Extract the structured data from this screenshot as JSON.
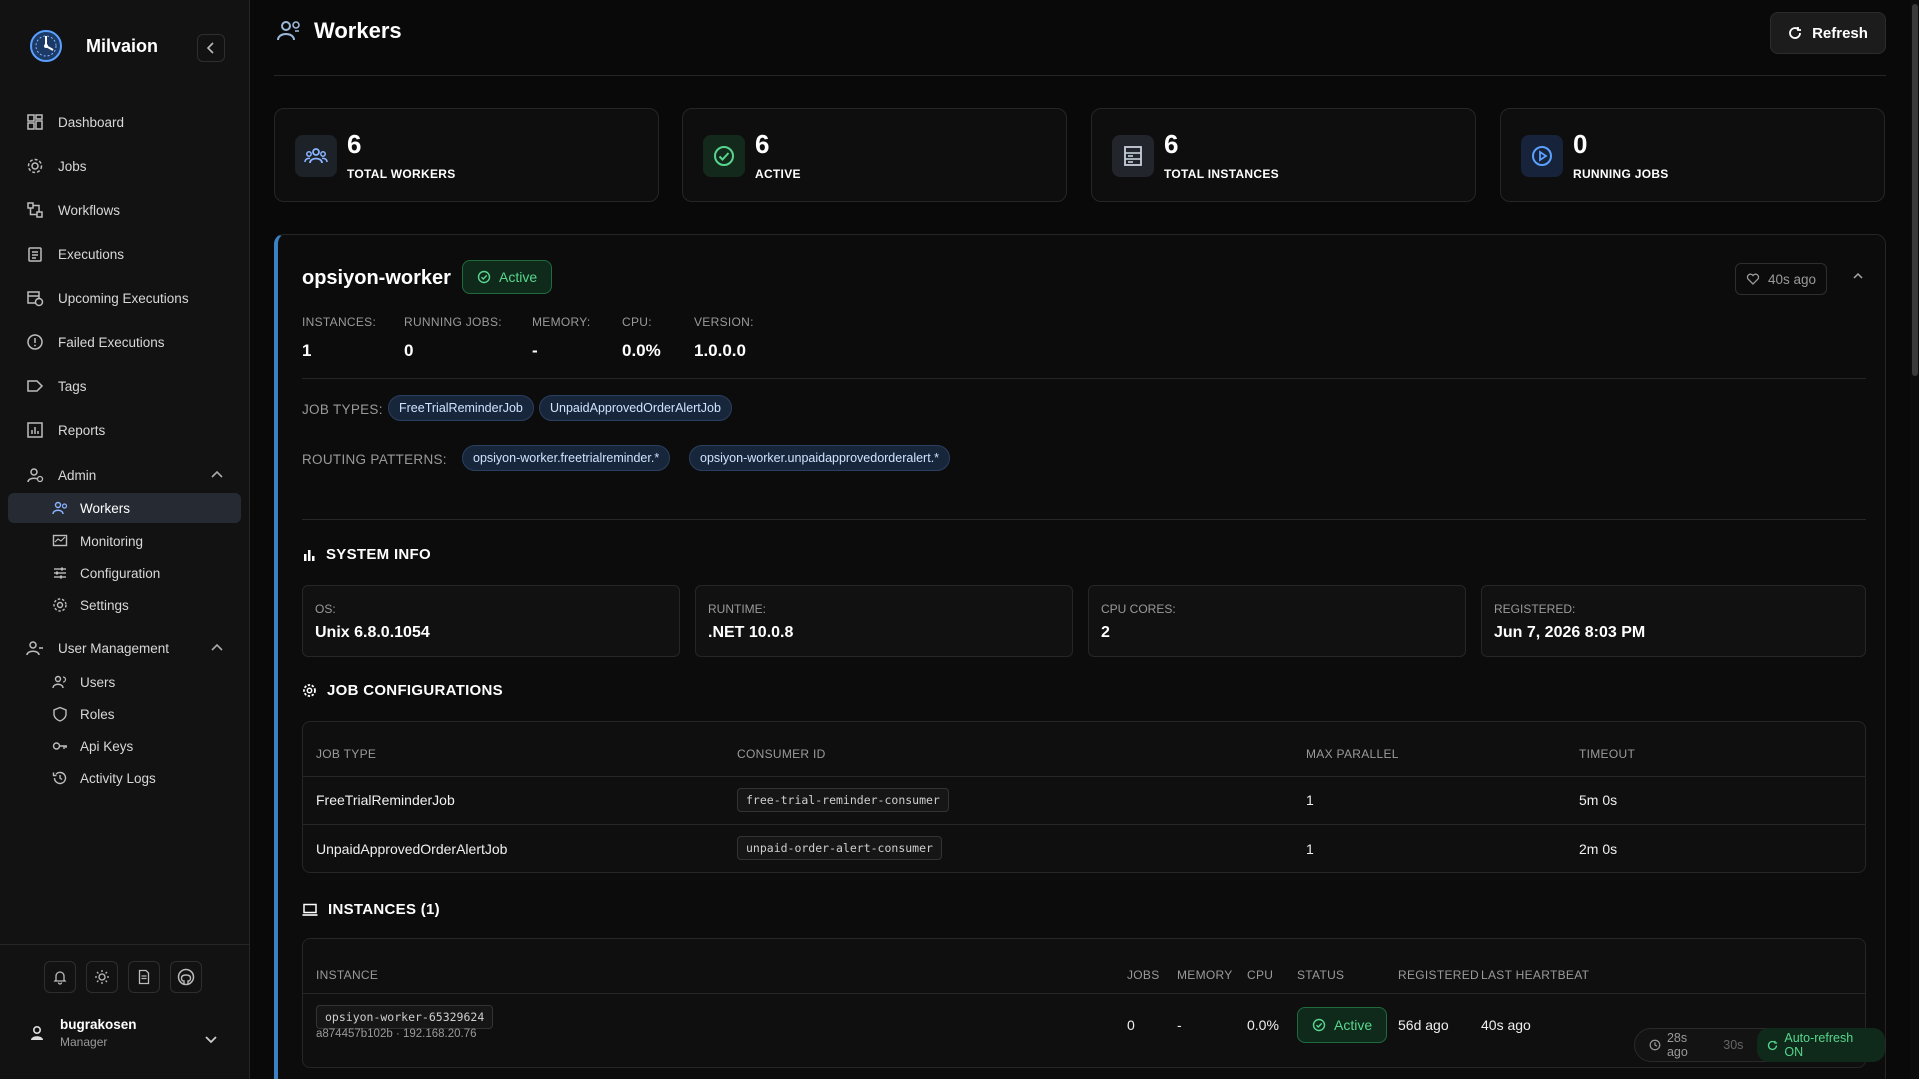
{
  "app": {
    "name": "Milvaion"
  },
  "sidebar": {
    "items": [
      {
        "label": "Dashboard",
        "icon": "dashboard-icon"
      },
      {
        "label": "Jobs",
        "icon": "gear-icon"
      },
      {
        "label": "Workflows",
        "icon": "workflow-icon"
      },
      {
        "label": "Executions",
        "icon": "clipboard-icon"
      },
      {
        "label": "Upcoming Executions",
        "icon": "calendar-clock-icon"
      },
      {
        "label": "Failed Executions",
        "icon": "alert-circle-icon"
      },
      {
        "label": "Tags",
        "icon": "tag-icon"
      },
      {
        "label": "Reports",
        "icon": "bar-chart-icon"
      }
    ],
    "admin": {
      "label": "Admin",
      "children": [
        {
          "label": "Workers",
          "icon": "workers-icon"
        },
        {
          "label": "Monitoring",
          "icon": "monitor-icon"
        },
        {
          "label": "Configuration",
          "icon": "sliders-icon"
        },
        {
          "label": "Settings",
          "icon": "cog-icon"
        }
      ]
    },
    "user_management": {
      "label": "User Management",
      "children": [
        {
          "label": "Users",
          "icon": "users-icon"
        },
        {
          "label": "Roles",
          "icon": "shield-icon"
        },
        {
          "label": "Api Keys",
          "icon": "key-icon"
        },
        {
          "label": "Activity Logs",
          "icon": "history-icon"
        }
      ]
    },
    "user": {
      "name": "bugrakosen",
      "role": "Manager"
    }
  },
  "header": {
    "title": "Workers",
    "refresh_label": "Refresh"
  },
  "stats": [
    {
      "value": "6",
      "label": "TOTAL WORKERS",
      "icon": "users-icon",
      "color": "#8ab4ff"
    },
    {
      "value": "6",
      "label": "ACTIVE",
      "icon": "check-circle-icon",
      "color": "#58d68d"
    },
    {
      "value": "6",
      "label": "TOTAL INSTANCES",
      "icon": "server-icon",
      "color": "#c8d0dc"
    },
    {
      "value": "0",
      "label": "RUNNING JOBS",
      "icon": "play-circle-icon",
      "color": "#5aa0ff"
    }
  ],
  "worker": {
    "name": "opsiyon-worker",
    "status": "Active",
    "heartbeat": "40s ago",
    "metrics": [
      {
        "label": "INSTANCES:",
        "value": "1"
      },
      {
        "label": "RUNNING JOBS:",
        "value": "0"
      },
      {
        "label": "MEMORY:",
        "value": "-"
      },
      {
        "label": "CPU:",
        "value": "0.0%"
      },
      {
        "label": "VERSION:",
        "value": "1.0.0.0"
      }
    ],
    "job_types_label": "JOB TYPES:",
    "job_types": [
      "FreeTrialReminderJob",
      "UnpaidApprovedOrderAlertJob"
    ],
    "routing_label": "ROUTING PATTERNS:",
    "routing_patterns": [
      "opsiyon-worker.freetrialreminder.*",
      "opsiyon-worker.unpaidapprovedorderalert.*"
    ],
    "system_info": {
      "title": "SYSTEM INFO",
      "items": [
        {
          "label": "OS:",
          "value": "Unix 6.8.0.1054"
        },
        {
          "label": "RUNTIME:",
          "value": ".NET 10.0.8"
        },
        {
          "label": "CPU CORES:",
          "value": "2"
        },
        {
          "label": "REGISTERED:",
          "value": "Jun 7, 2026 8:03 PM"
        }
      ]
    },
    "job_configs": {
      "title": "JOB CONFIGURATIONS",
      "columns": [
        "JOB TYPE",
        "CONSUMER ID",
        "MAX PARALLEL",
        "TIMEOUT"
      ],
      "rows": [
        {
          "job_type": "FreeTrialReminderJob",
          "consumer_id": "free-trial-reminder-consumer",
          "max_parallel": "1",
          "timeout": "5m 0s"
        },
        {
          "job_type": "UnpaidApprovedOrderAlertJob",
          "consumer_id": "unpaid-order-alert-consumer",
          "max_parallel": "1",
          "timeout": "2m 0s"
        }
      ]
    },
    "instances": {
      "title": "INSTANCES (1)",
      "columns": [
        "INSTANCE",
        "JOBS",
        "MEMORY",
        "CPU",
        "STATUS",
        "REGISTERED",
        "LAST HEARTBEAT"
      ],
      "rows": [
        {
          "instance": "opsiyon-worker-65329624",
          "sub": "a874457b102b · 192.168.20.76",
          "jobs": "0",
          "memory": "-",
          "cpu": "0.0%",
          "status": "Active",
          "registered": "56d ago",
          "last_heartbeat": "40s ago"
        }
      ]
    }
  },
  "autorefresh": {
    "last": "28s ago",
    "interval": "30s",
    "state": "Auto-refresh ON"
  }
}
